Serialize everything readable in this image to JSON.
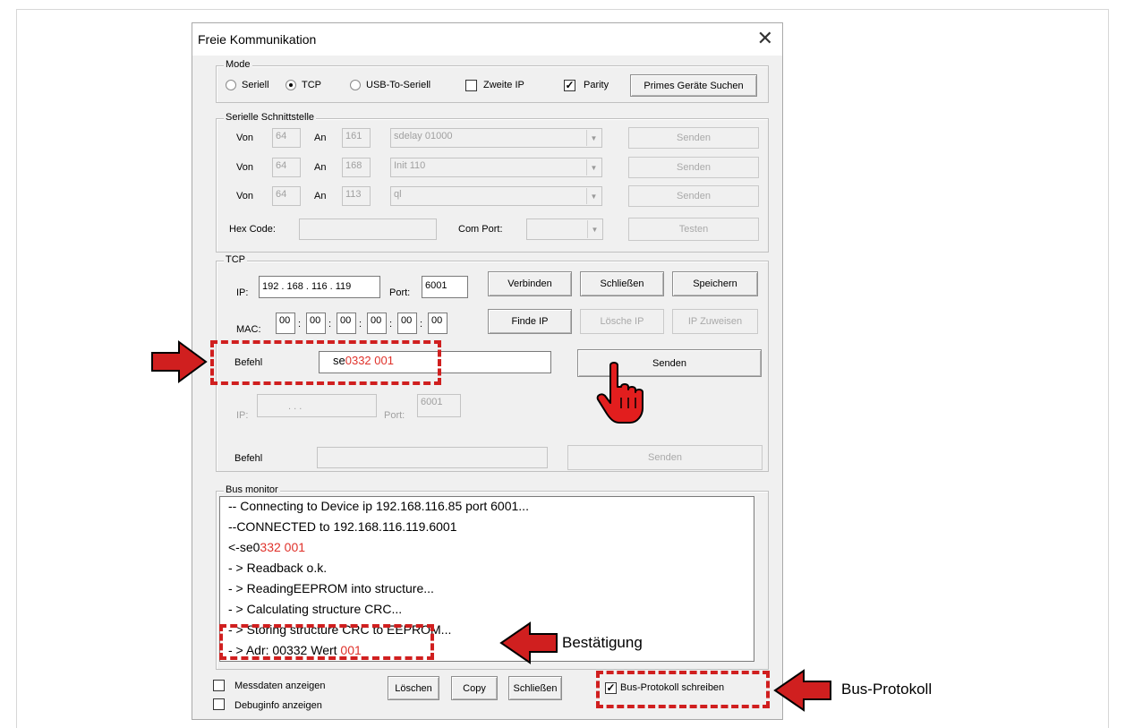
{
  "dialog": {
    "title": "Freie Kommunikation"
  },
  "mode": {
    "label": "Mode",
    "seriell": "Seriell",
    "tcp": "TCP",
    "usb": "USB-To-Seriell",
    "zweite_ip": "Zweite IP",
    "parity": "Parity",
    "suchen_button": "Primes Geräte Suchen"
  },
  "serial": {
    "label": "Serielle Schnittstelle",
    "von_label": "Von",
    "an_label": "An",
    "rows": [
      {
        "von": "64",
        "an": "161",
        "cmd": "sdelay 01000",
        "send": "Senden"
      },
      {
        "von": "64",
        "an": "168",
        "cmd": "Init 110",
        "send": "Senden"
      },
      {
        "von": "64",
        "an": "113",
        "cmd": "ql",
        "send": "Senden"
      }
    ],
    "hex_label": "Hex Code:",
    "com_port_label": "Com Port:",
    "test_button": "Testen"
  },
  "tcp": {
    "label": "TCP",
    "ip_label": "IP:",
    "ip_value": "192 . 168 . 116 . 119",
    "port_label": "Port:",
    "port_value": "6001",
    "verbinden": "Verbinden",
    "schliessen": "Schließen",
    "speichern": "Speichern",
    "mac_label": "MAC:",
    "mac": [
      "00",
      "00",
      "00",
      "00",
      "00",
      "00"
    ],
    "mac_sep": ":",
    "finde_ip": "Finde IP",
    "loesche_ip": "Lösche IP",
    "ip_zuweisen": "IP Zuweisen",
    "befehl_label": "Befehl",
    "befehl_prefix": "se",
    "befehl_highlight": "0332 001",
    "senden": "Senden",
    "ip2_label": "IP:",
    "ip2_value": ".      .      .",
    "port2_label": "Port:",
    "port2_value": "6001",
    "befehl2_label": "Befehl",
    "senden2": "Senden"
  },
  "bus": {
    "label": "Bus monitor",
    "line1": "-- Connecting to Device ip 192.168.116.85 port 6001...",
    "line2": "--CONNECTED to 192.168.116.119.6001",
    "line3_prefix": "<-se0",
    "line3_highlight": "332 001",
    "line4": "- > Readback o.k.",
    "line5": "- > ReadingEEPROM into structure...",
    "line6": "- > Calculating structure CRC...",
    "line7": "- > Storing structure CRC to EEPROM...",
    "line8_prefix": "- > Adr: 00332 Wert ",
    "line8_highlight": "001"
  },
  "bottom": {
    "messdaten": "Messdaten anzeigen",
    "debuginfo": "Debuginfo anzeigen",
    "loeschen": "Löschen",
    "copy": "Copy",
    "schliessen": "Schließen",
    "bus_protokoll": "Bus-Protokoll schreiben"
  },
  "callouts": {
    "bestaetigung": "Bestätigung",
    "bus_protokoll": "Bus-Protokoll"
  },
  "colors": {
    "accent_red": "#d01f1f",
    "highlight_text": "#e0322b"
  }
}
